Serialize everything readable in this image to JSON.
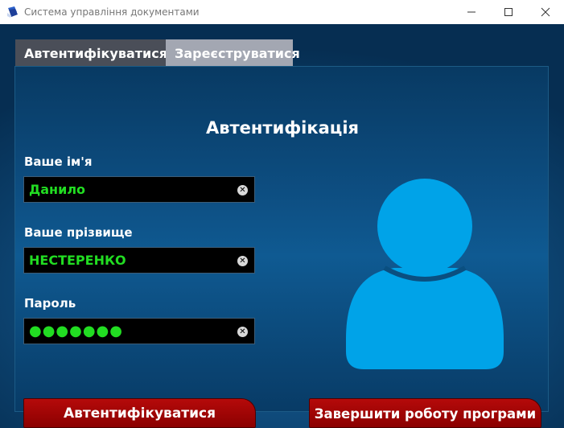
{
  "window": {
    "title": "Система управління документами",
    "icon": "document-app-icon"
  },
  "tabs": [
    {
      "label": "Автентифікуватися",
      "active": true
    },
    {
      "label": "Зареєструватися",
      "active": false
    }
  ],
  "panel": {
    "title": "Автентифікація"
  },
  "fields": {
    "first_name": {
      "label": "Ваше ім'я",
      "value": "Данило"
    },
    "last_name": {
      "label": "Ваше прізвище",
      "value": "НЕСТЕРЕНКО"
    },
    "password": {
      "label": "Пароль",
      "value": "●●●●●●●"
    }
  },
  "buttons": {
    "authenticate": "Автентифікуватися",
    "exit": "Завершити роботу програми"
  },
  "colors": {
    "input_text": "#22dd22",
    "button_red": "#a00000",
    "avatar": "#00a3e8",
    "tab_active": "#4a4e58",
    "tab_inactive": "#a3a7b2"
  }
}
